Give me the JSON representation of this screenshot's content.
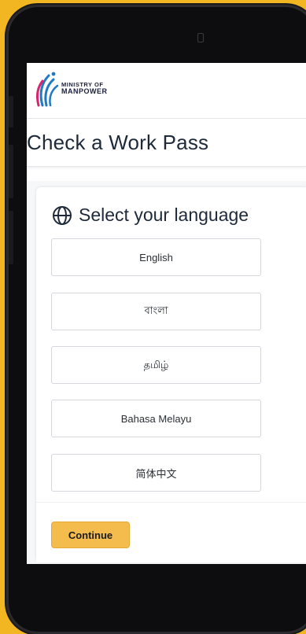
{
  "header": {
    "logo_line1": "MINISTRY OF",
    "logo_line2": "MANPOWER"
  },
  "page": {
    "title": "Check a Work Pass"
  },
  "language_selector": {
    "heading": "Select your language",
    "options": [
      {
        "label": "English"
      },
      {
        "label": "বাংলা"
      },
      {
        "label": "தமிழ்"
      },
      {
        "label": "Bahasa Melayu"
      },
      {
        "label": "简体中文"
      }
    ],
    "continue_label": "Continue"
  },
  "colors": {
    "background": "#f3b623",
    "accent_button": "#f4bb4d",
    "logo_blue": "#1f7ac4",
    "logo_pink": "#d6246e"
  }
}
